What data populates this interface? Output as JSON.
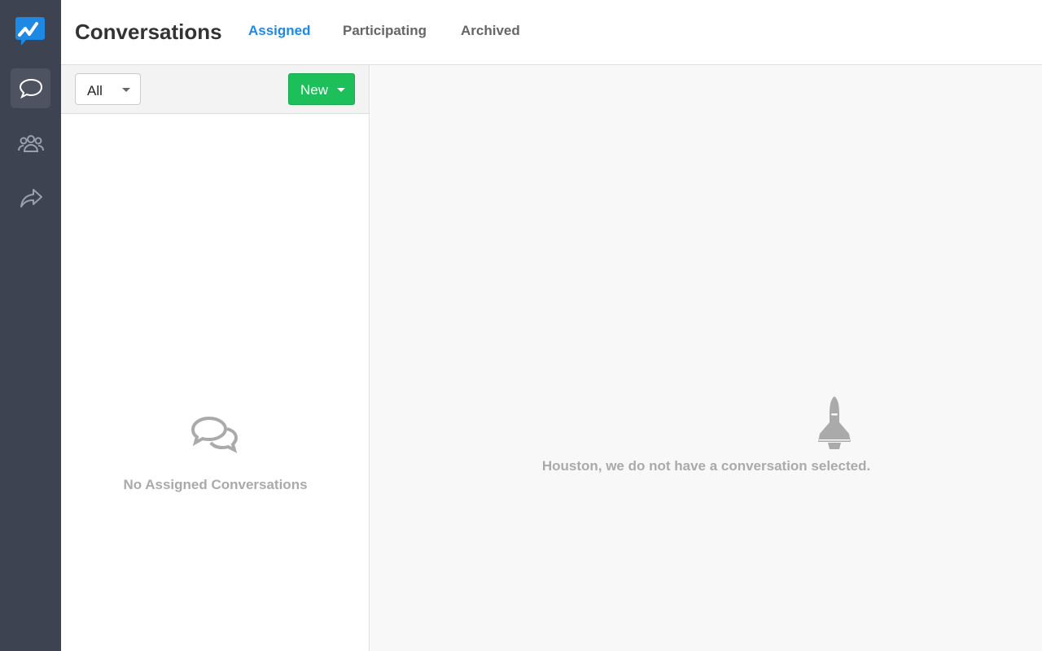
{
  "sidebar": {
    "items": [
      {
        "name": "conversations",
        "active": true
      },
      {
        "name": "contacts"
      },
      {
        "name": "share"
      }
    ]
  },
  "header": {
    "title": "Conversations",
    "tabs": [
      {
        "label": "Assigned",
        "active": true
      },
      {
        "label": "Participating"
      },
      {
        "label": "Archived"
      }
    ]
  },
  "list": {
    "filter": "All",
    "new_label": "New",
    "empty_text": "No Assigned Conversations"
  },
  "detail": {
    "empty_text": "Houston, we do not have a conversation selected."
  },
  "colors": {
    "accent": "#1e88e5",
    "new_button": "#1dbf5a",
    "sidebar": "#3d4350"
  }
}
